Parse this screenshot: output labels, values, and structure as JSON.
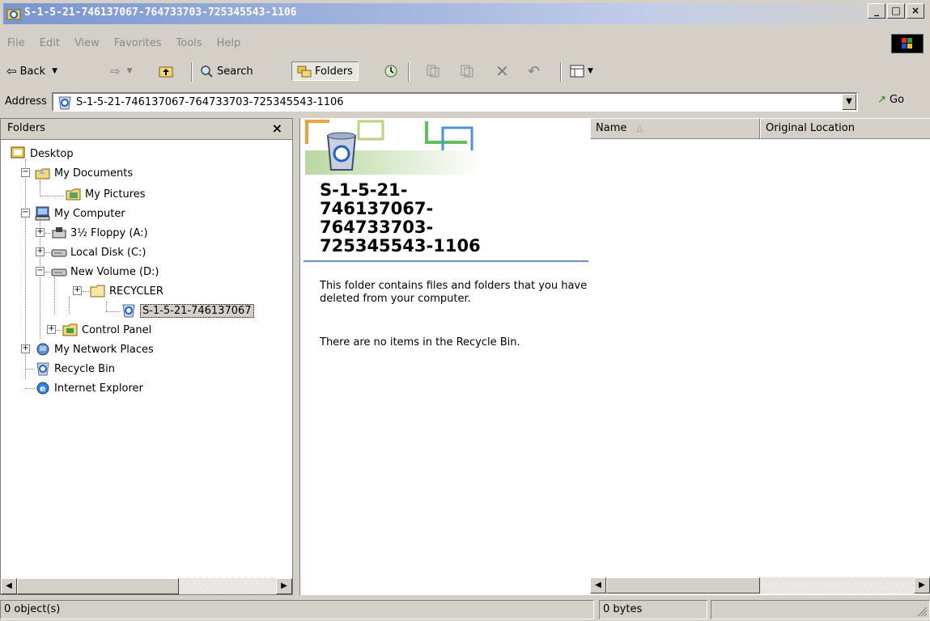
{
  "window": {
    "title": "S-1-5-21-746137067-764733703-725345543-1106",
    "minimize": "_",
    "maximize": "□",
    "close": "×"
  },
  "menu": [
    "File",
    "Edit",
    "View",
    "Favorites",
    "Tools",
    "Help"
  ],
  "toolbar": {
    "back": "Back",
    "search": "Search",
    "folders": "Folders"
  },
  "address": {
    "label": "Address",
    "value": "S-1-5-21-746137067-764733703-725345543-1106",
    "go": "Go"
  },
  "folders_pane": {
    "title": "Folders",
    "close": "×",
    "tree": [
      {
        "label": "Desktop",
        "icon": "desktop-icon"
      },
      {
        "label": "My Documents",
        "icon": "my-documents-icon"
      },
      {
        "label": "My Pictures",
        "icon": "my-pictures-icon"
      },
      {
        "label": "My Computer",
        "icon": "my-computer-icon"
      },
      {
        "label": "3½ Floppy (A:)",
        "icon": "floppy-icon"
      },
      {
        "label": "Local Disk (C:)",
        "icon": "hard-disk-icon"
      },
      {
        "label": "New Volume (D:)",
        "icon": "hard-disk-icon"
      },
      {
        "label": "RECYCLER",
        "icon": "folder-icon"
      },
      {
        "label": "S-1-5-21-746137067",
        "icon": "recycle-bin-icon"
      },
      {
        "label": "Control Panel",
        "icon": "control-panel-icon"
      },
      {
        "label": "My Network Places",
        "icon": "network-places-icon"
      },
      {
        "label": "Recycle Bin",
        "icon": "recycle-bin-icon"
      },
      {
        "label": "Internet Explorer",
        "icon": "internet-explorer-icon"
      }
    ]
  },
  "info": {
    "title_lines": [
      "S-1-5-21-",
      "746137067-",
      "764733703-",
      "725345543-1106"
    ],
    "description": "This folder contains files and folders that you have deleted from your computer.",
    "empty": "There are no items in the Recycle Bin."
  },
  "list": {
    "columns": [
      "Name",
      "Original Location"
    ]
  },
  "status": {
    "objects": "0 object(s)",
    "size": "0 bytes"
  }
}
